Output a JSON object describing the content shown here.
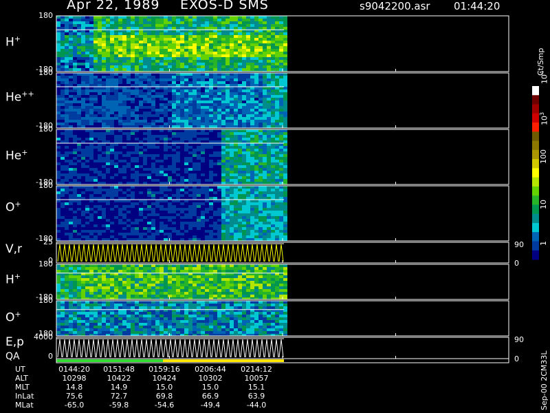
{
  "header": {
    "date": "Apr 22, 1989",
    "instrument": "EXOS-D SMS",
    "filename": "s9042200.asr",
    "time": "01:44:20"
  },
  "panels": [
    {
      "id": "h-plus",
      "base": "H",
      "charge": "+",
      "top_tick": "180",
      "bottom_tick": "-180"
    },
    {
      "id": "he-plus-plus",
      "base": "He",
      "charge": "++",
      "top_tick": "180",
      "bottom_tick": "-180"
    },
    {
      "id": "he-plus",
      "base": "He",
      "charge": "+",
      "top_tick": "180",
      "bottom_tick": "-180"
    },
    {
      "id": "o-plus",
      "base": "O",
      "charge": "+",
      "top_tick": "180",
      "bottom_tick": "-180"
    },
    {
      "id": "vr",
      "base": "V,r",
      "charge": "",
      "top_tick": "25",
      "bottom_tick": "0",
      "right_top": "90",
      "right_bottom": "0"
    },
    {
      "id": "h-plus-2",
      "base": "H",
      "charge": "+",
      "top_tick": "180",
      "bottom_tick": "-180"
    },
    {
      "id": "o-plus-2",
      "base": "O",
      "charge": "+",
      "top_tick": "180",
      "bottom_tick": "-180"
    },
    {
      "id": "ep",
      "base": "E,p",
      "charge": "",
      "top_tick": "4000",
      "bottom_tick": "0",
      "right_top": "90",
      "right_bottom": "0"
    }
  ],
  "qa_label": "QA",
  "colorbar": {
    "unit": "Ct/Smp",
    "labels": [
      {
        "base": "10",
        "exp": "4"
      },
      {
        "base": "10",
        "exp": "3"
      },
      {
        "base": "100",
        "exp": ""
      },
      {
        "base": "10",
        "exp": ""
      },
      {
        "base": "1",
        "exp": ""
      }
    ],
    "colors": [
      "#ffffff",
      "#6e0000",
      "#a00000",
      "#d00000",
      "#ff1e00",
      "#6e5a00",
      "#8c7800",
      "#aa9600",
      "#d2c800",
      "#ffff00",
      "#b4e600",
      "#64d200",
      "#28b428",
      "#009650",
      "#008c8c",
      "#00c8d2",
      "#0064b4",
      "#003ca0",
      "#000080"
    ]
  },
  "table": {
    "rows": [
      {
        "name": "UT",
        "values": [
          "0144:20",
          "0151:48",
          "0159:16",
          "0206:44",
          "0214:12"
        ]
      },
      {
        "name": "ALT",
        "values": [
          "10298",
          "10422",
          "10424",
          "10302",
          "10057"
        ]
      },
      {
        "name": "MLT",
        "values": [
          "14.8",
          "14.9",
          "15.0",
          "15.0",
          "15.1"
        ]
      },
      {
        "name": "InLat",
        "values": [
          "75.6",
          "72.7",
          "69.8",
          "66.9",
          "63.9"
        ]
      },
      {
        "name": "MLat",
        "values": [
          "-65.0",
          "-59.8",
          "-54.6",
          "-49.4",
          "-44.0"
        ]
      }
    ]
  },
  "footer_label": "Sep-00 2CM33L",
  "chart_data": {
    "type": "heatmap",
    "title": "Apr 22, 1989   EXOS-D SMS",
    "xlabel": "UT",
    "x_ticks": [
      "0144:20",
      "0151:48",
      "0159:16",
      "0206:44",
      "0214:12"
    ],
    "panels": [
      {
        "label": "H+",
        "ylim": [
          -180,
          180
        ]
      },
      {
        "label": "He++",
        "ylim": [
          -180,
          180
        ]
      },
      {
        "label": "He+",
        "ylim": [
          -180,
          180
        ]
      },
      {
        "label": "O+",
        "ylim": [
          -180,
          180
        ]
      },
      {
        "label": "V,r",
        "ylim": [
          0,
          25
        ],
        "y2lim": [
          0,
          90
        ]
      },
      {
        "label": "H+",
        "ylim": [
          -180,
          180
        ]
      },
      {
        "label": "O+",
        "ylim": [
          -180,
          180
        ]
      },
      {
        "label": "E,p",
        "ylim": [
          0,
          4000
        ],
        "y2lim": [
          0,
          90
        ]
      }
    ],
    "colorscale": {
      "unit": "Ct/Smp",
      "log": true,
      "range": [
        1,
        10000
      ]
    },
    "grid": false
  }
}
